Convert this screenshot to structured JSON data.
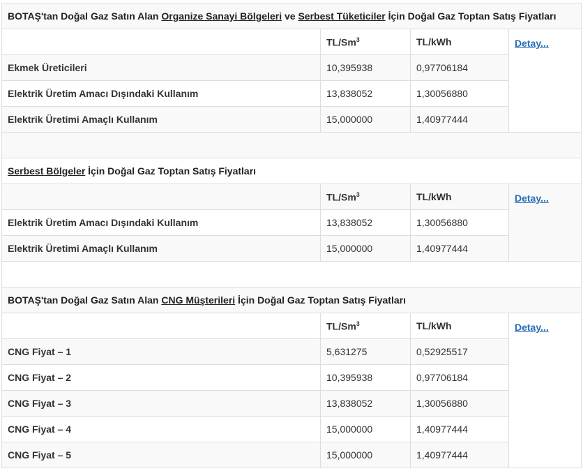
{
  "section1": {
    "title_pre": "BOTAŞ'tan Doğal Gaz Satın Alan ",
    "title_link1": "Organize Sanayi Bölgeleri",
    "title_mid": " ve ",
    "title_link2": "Serbest Tüketiciler",
    "title_post": " İçin Doğal Gaz Toptan Satış Fiyatları",
    "col_unit1": "TL/Sm",
    "col_unit1_sup": "3",
    "col_unit2": "TL/kWh",
    "detail_link": "Detay...",
    "rows": [
      {
        "name": "Ekmek Üreticileri",
        "sm3": "10,395938",
        "kwh": "0,97706184"
      },
      {
        "name": "Elektrik Üretim Amacı Dışındaki Kullanım",
        "sm3": "13,838052",
        "kwh": "1,30056880"
      },
      {
        "name": "Elektrik Üretimi Amaçlı Kullanım",
        "sm3": "15,000000",
        "kwh": "1,40977444"
      }
    ]
  },
  "section2": {
    "title_link": "Serbest Bölgeler",
    "title_post": " İçin Doğal Gaz Toptan Satış Fiyatları",
    "col_unit1": "TL/Sm",
    "col_unit1_sup": "3",
    "col_unit2": "TL/kWh",
    "detail_link": "Detay...",
    "rows": [
      {
        "name": "Elektrik Üretim Amacı Dışındaki Kullanım",
        "sm3": "13,838052",
        "kwh": "1,30056880"
      },
      {
        "name": "Elektrik Üretimi Amaçlı Kullanım",
        "sm3": "15,000000",
        "kwh": "1,40977444"
      }
    ]
  },
  "section3": {
    "title_pre": "BOTAŞ'tan Doğal Gaz Satın Alan ",
    "title_link": "CNG Müşterileri",
    "title_post": " İçin Doğal Gaz Toptan Satış Fiyatları",
    "col_unit1": "TL/Sm",
    "col_unit1_sup": "3",
    "col_unit2": "TL/kWh",
    "detail_link": "Detay...",
    "rows": [
      {
        "name": "CNG Fiyat – 1",
        "sm3": "5,631275",
        "kwh": "0,52925517"
      },
      {
        "name": "CNG Fiyat – 2",
        "sm3": "10,395938",
        "kwh": "0,97706184"
      },
      {
        "name": "CNG Fiyat – 3",
        "sm3": "13,838052",
        "kwh": "1,30056880"
      },
      {
        "name": "CNG Fiyat – 4",
        "sm3": "15,000000",
        "kwh": "1,40977444"
      },
      {
        "name": "CNG Fiyat – 5",
        "sm3": "15,000000",
        "kwh": "1,40977444"
      }
    ]
  }
}
